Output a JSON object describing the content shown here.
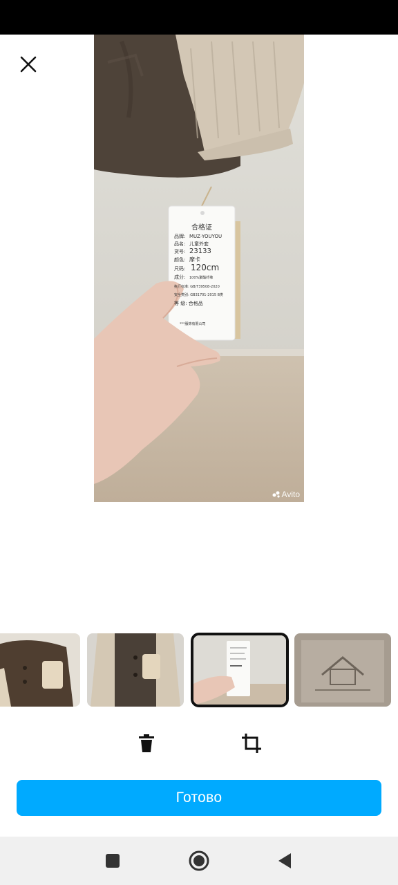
{
  "photo": {
    "tag": {
      "title": "合格证",
      "rows": [
        {
          "label": "品牌:",
          "value": "MUZ·YOUYOU"
        },
        {
          "label": "品名:",
          "value": "儿童外套"
        },
        {
          "label": "货号:",
          "value": "23133"
        },
        {
          "label": "颜色:",
          "value": "摩卡"
        },
        {
          "label": "尺码:",
          "value": "120cm"
        },
        {
          "label": "成分:",
          "value": "100%聚酯纤维"
        }
      ],
      "standard": "执行标准: GB/T39508-2020",
      "safety": "安全类别: GB31701-2015 B类",
      "grade": "等 级: 合格品",
      "company": "***服饰有限公司"
    },
    "watermark": "Avito"
  },
  "thumbnails": [
    {
      "name": "thumbnail-1",
      "selected": false
    },
    {
      "name": "thumbnail-2",
      "selected": false
    },
    {
      "name": "thumbnail-3",
      "selected": true
    },
    {
      "name": "thumbnail-4",
      "selected": false
    }
  ],
  "icons": {
    "close": "close-icon",
    "delete": "trash-icon",
    "crop": "crop-icon",
    "nav_recent": "square-icon",
    "nav_home": "circle-icon",
    "nav_back": "triangle-back-icon"
  },
  "done_button": {
    "label": "Готово"
  },
  "colors": {
    "accent": "#00aaff",
    "selected_border": "#111111"
  }
}
